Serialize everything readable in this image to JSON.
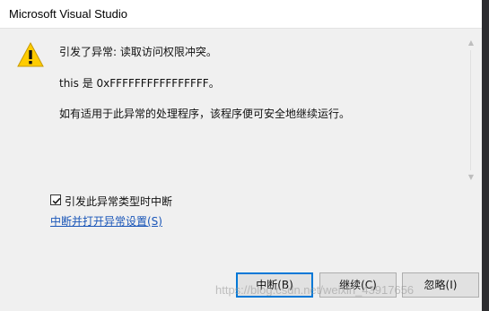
{
  "window": {
    "title": "Microsoft Visual Studio"
  },
  "message": {
    "icon": "warning-icon",
    "line1": "引发了异常: 读取访问权限冲突。",
    "line2": "this 是 0xFFFFFFFFFFFFFFFF。",
    "line3": "如有适用于此异常的处理程序，该程序便可安全地继续运行。"
  },
  "options": {
    "checkbox_label": "引发此异常类型时中断",
    "checkbox_checked": true,
    "settings_link": "中断并打开异常设置(S)"
  },
  "buttons": {
    "break": "中断(B)",
    "continue": "继续(C)",
    "ignore": "忽略(I)"
  },
  "watermark": "https://blog.csdn.net/weixin_43917656",
  "colors": {
    "warning": "#ffcc00",
    "link": "#1a56b8",
    "accent": "#0078d7"
  }
}
